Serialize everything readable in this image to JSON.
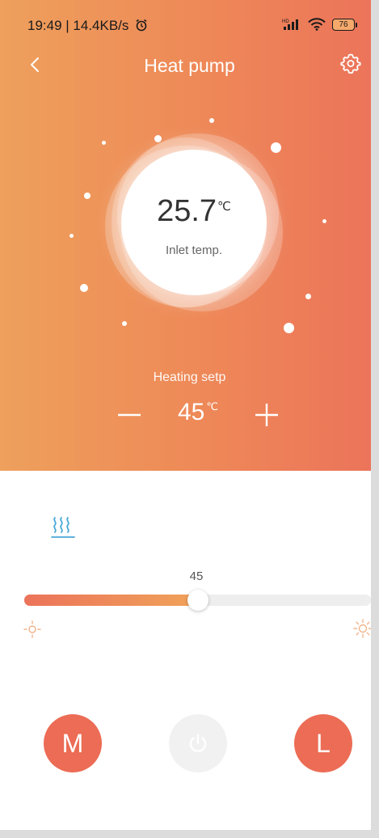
{
  "status_bar": {
    "time_speed": "19:49 | 14.4KB/s",
    "battery": "76"
  },
  "header": {
    "title": "Heat pump"
  },
  "inlet": {
    "value": "25.7",
    "unit": "℃",
    "label": "Inlet temp."
  },
  "setpoint": {
    "label": "Heating setp",
    "value": "45",
    "unit": "℃"
  },
  "slider": {
    "value_label": "45",
    "fraction": 0.5
  },
  "buttons": {
    "m_label": "M",
    "l_label": "L"
  },
  "colors": {
    "accent": "#ec6c55",
    "gradient_start": "#eea05c",
    "gradient_end": "#ec735a",
    "mode_icon": "#4aa8d8"
  },
  "icons": {
    "status": [
      "alarm-clock-icon",
      "hd-signal-icon",
      "wifi-icon",
      "battery-icon"
    ],
    "header": [
      "back-arrow-icon",
      "gear-icon"
    ],
    "controls": [
      "minus-icon",
      "plus-icon",
      "heating-waves-icon",
      "sun-low-icon",
      "sun-high-icon",
      "power-icon"
    ]
  }
}
